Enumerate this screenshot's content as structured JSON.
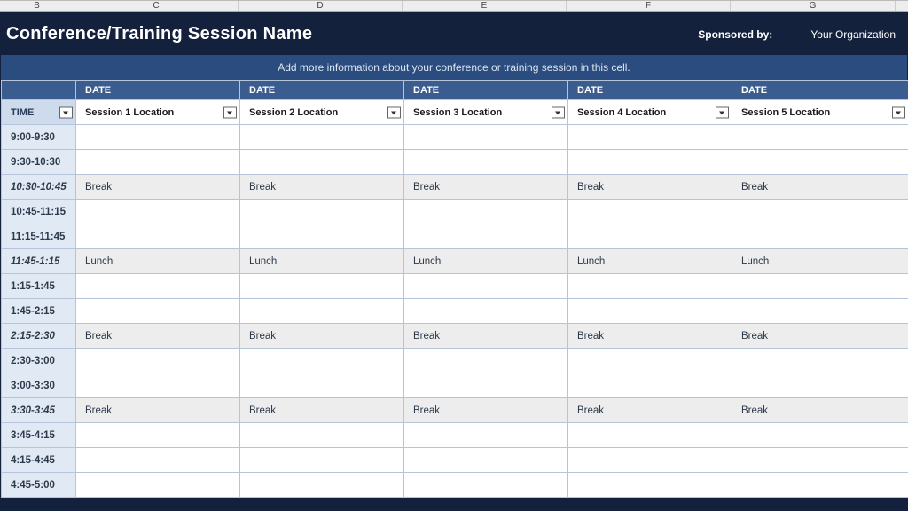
{
  "colLetters": [
    "B",
    "C",
    "D",
    "E",
    "F",
    "G",
    ""
  ],
  "colClasses": [
    "cl-b",
    "cl-c",
    "cl-d",
    "cl-e",
    "cl-f",
    "cl-g",
    "cl-h"
  ],
  "header": {
    "title": "Conference/Training Session Name",
    "sponsoredLabel": "Sponsored by:",
    "orgName": "Your Organization"
  },
  "infoBand": "Add more information about your conference or training session in this cell.",
  "tableHeader": {
    "dateLabel": "DATE",
    "timeLabel": "TIME",
    "sessions": [
      "Session 1 Location",
      "Session 2 Location",
      "Session 3 Location",
      "Session 4 Location",
      "Session 5 Location"
    ]
  },
  "rows": [
    {
      "time": "9:00-9:30",
      "shaded": false,
      "italic": false,
      "cells": [
        "",
        "",
        "",
        "",
        ""
      ]
    },
    {
      "time": "9:30-10:30",
      "shaded": false,
      "italic": false,
      "cells": [
        "",
        "",
        "",
        "",
        ""
      ]
    },
    {
      "time": "10:30-10:45",
      "shaded": true,
      "italic": true,
      "cells": [
        "Break",
        "Break",
        "Break",
        "Break",
        "Break"
      ]
    },
    {
      "time": "10:45-11:15",
      "shaded": false,
      "italic": false,
      "cells": [
        "",
        "",
        "",
        "",
        ""
      ]
    },
    {
      "time": "11:15-11:45",
      "shaded": false,
      "italic": false,
      "cells": [
        "",
        "",
        "",
        "",
        ""
      ]
    },
    {
      "time": "11:45-1:15",
      "shaded": true,
      "italic": true,
      "cells": [
        "Lunch",
        "Lunch",
        "Lunch",
        "Lunch",
        "Lunch"
      ]
    },
    {
      "time": "1:15-1:45",
      "shaded": false,
      "italic": false,
      "cells": [
        "",
        "",
        "",
        "",
        ""
      ]
    },
    {
      "time": "1:45-2:15",
      "shaded": false,
      "italic": false,
      "cells": [
        "",
        "",
        "",
        "",
        ""
      ]
    },
    {
      "time": "2:15-2:30",
      "shaded": true,
      "italic": true,
      "cells": [
        "Break",
        "Break",
        "Break",
        "Break",
        "Break"
      ]
    },
    {
      "time": "2:30-3:00",
      "shaded": false,
      "italic": false,
      "cells": [
        "",
        "",
        "",
        "",
        ""
      ]
    },
    {
      "time": "3:00-3:30",
      "shaded": false,
      "italic": false,
      "cells": [
        "",
        "",
        "",
        "",
        ""
      ]
    },
    {
      "time": "3:30-3:45",
      "shaded": true,
      "italic": true,
      "cells": [
        "Break",
        "Break",
        "Break",
        "Break",
        "Break"
      ]
    },
    {
      "time": "3:45-4:15",
      "shaded": false,
      "italic": false,
      "cells": [
        "",
        "",
        "",
        "",
        ""
      ]
    },
    {
      "time": "4:15-4:45",
      "shaded": false,
      "italic": false,
      "cells": [
        "",
        "",
        "",
        "",
        ""
      ]
    },
    {
      "time": "4:45-5:00",
      "shaded": false,
      "italic": false,
      "cells": [
        "",
        "",
        "",
        "",
        ""
      ]
    }
  ]
}
